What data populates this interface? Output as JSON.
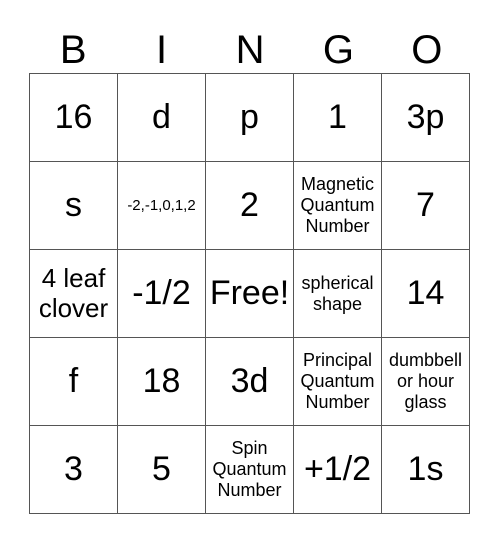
{
  "header": [
    "B",
    "I",
    "N",
    "G",
    "O"
  ],
  "rows": [
    [
      {
        "text": "16",
        "size": "xl"
      },
      {
        "text": "d",
        "size": "xl"
      },
      {
        "text": "p",
        "size": "xl"
      },
      {
        "text": "1",
        "size": "xl"
      },
      {
        "text": "3p",
        "size": "xl"
      }
    ],
    [
      {
        "text": "s",
        "size": "xl"
      },
      {
        "text": "-2,-1,0,1,2",
        "size": "s"
      },
      {
        "text": "2",
        "size": "xl"
      },
      {
        "text": "Magnetic Quantum Number",
        "size": "m"
      },
      {
        "text": "7",
        "size": "xl"
      }
    ],
    [
      {
        "text": "4 leaf clover",
        "size": "l"
      },
      {
        "text": "-1/2",
        "size": "xl"
      },
      {
        "text": "Free!",
        "size": "xl"
      },
      {
        "text": "spherical shape",
        "size": "m"
      },
      {
        "text": "14",
        "size": "xl"
      }
    ],
    [
      {
        "text": "f",
        "size": "xl"
      },
      {
        "text": "18",
        "size": "xl"
      },
      {
        "text": "3d",
        "size": "xl"
      },
      {
        "text": "Principal Quantum Number",
        "size": "m"
      },
      {
        "text": "dumbbell or hour glass",
        "size": "m"
      }
    ],
    [
      {
        "text": "3",
        "size": "xl"
      },
      {
        "text": "5",
        "size": "xl"
      },
      {
        "text": "Spin Quantum Number",
        "size": "m"
      },
      {
        "text": "+1/2",
        "size": "xl"
      },
      {
        "text": "1s",
        "size": "xl"
      }
    ]
  ]
}
